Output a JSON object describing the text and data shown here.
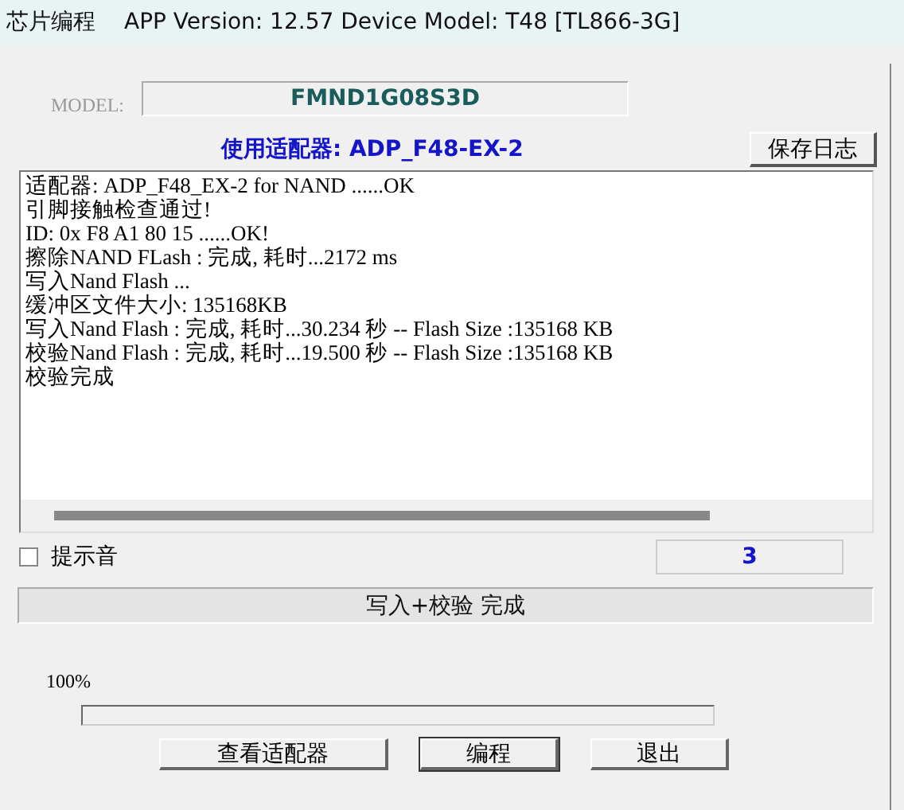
{
  "window": {
    "title": "芯片编程",
    "subtitle": "APP Version: 12.57 Device Model: T48 [TL866-3G]"
  },
  "model": {
    "label": "MODEL:",
    "value": "FMND1G08S3D"
  },
  "adapter": {
    "text": "使用适配器: ADP_F48-EX-2"
  },
  "save_log_button": "保存日志",
  "log": [
    "适配器:  ADP_F48_EX-2 for NAND  ......OK",
    "引脚接触检查通过!",
    "ID: 0x F8 A1 80 15 ......OK!",
    "擦除NAND FLash : 完成, 耗时...2172 ms",
    "写入Nand Flash ...",
    "缓冲区文件大小: 135168KB",
    "写入Nand Flash : 完成, 耗时...30.234 秒 --  Flash Size :135168 KB",
    "校验Nand Flash : 完成, 耗时...19.500 秒 --  Flash Size :135168 KB",
    "校验完成"
  ],
  "sound": {
    "label": "提示音",
    "checked": false
  },
  "counter": "3",
  "status": "写入+校验 完成",
  "progress": {
    "reading": "100%",
    "level": 0
  },
  "buttons": [
    {
      "label": "查看适配器",
      "default": false
    },
    {
      "label": "编程",
      "default": true
    },
    {
      "label": "退出",
      "default": false
    }
  ]
}
